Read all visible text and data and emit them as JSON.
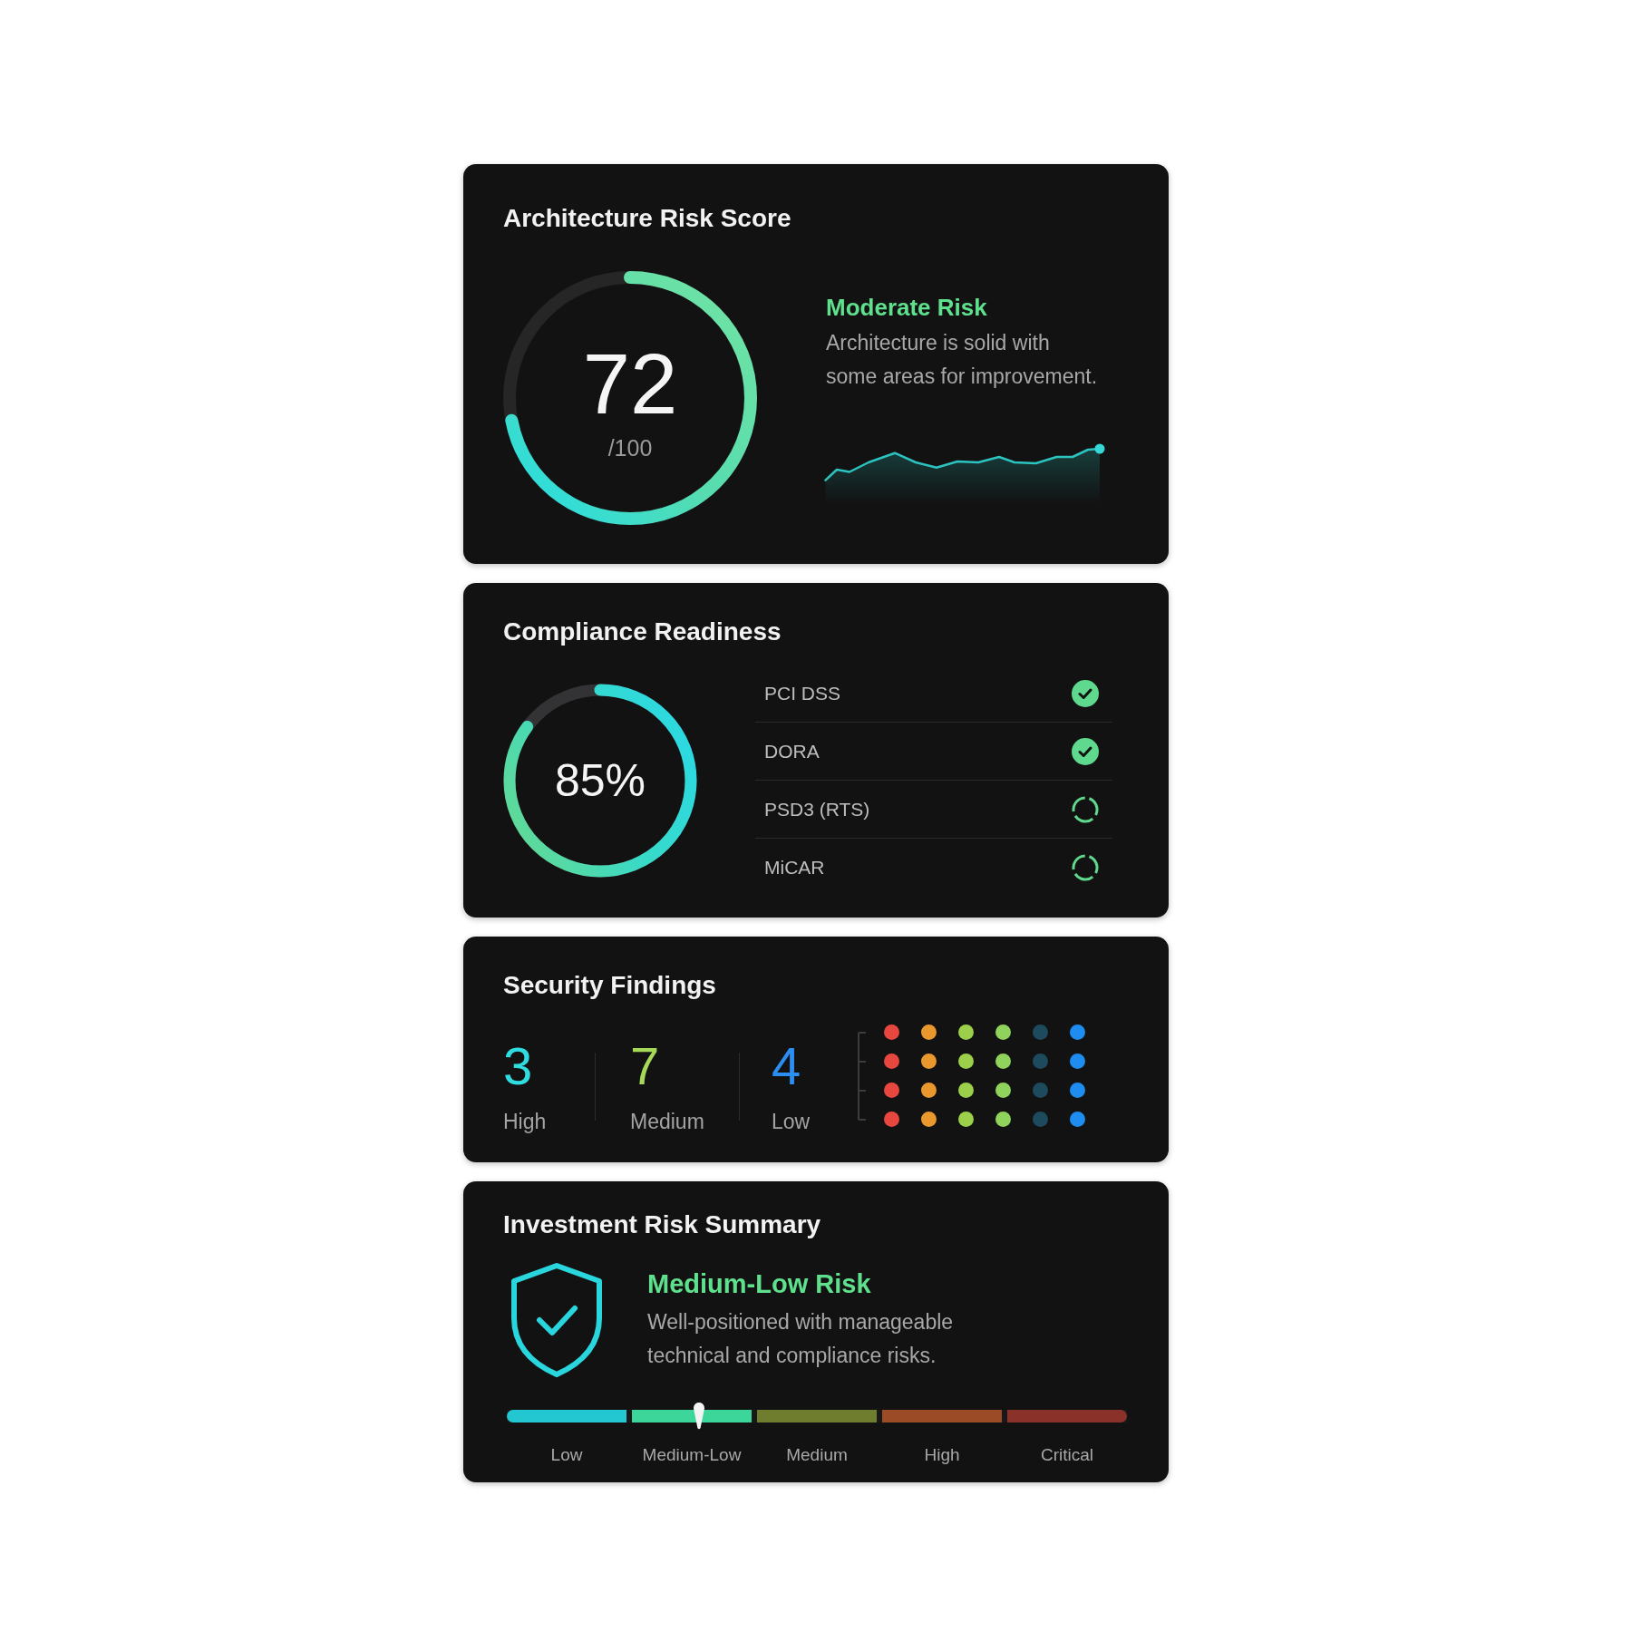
{
  "score_card": {
    "title": "Architecture Risk Score",
    "score": "72",
    "max": "/100",
    "level": 0.72,
    "status": "Moderate Risk",
    "description": "Architecture is solid with some areas for improvement."
  },
  "compliance": {
    "title": "Compliance Readiness",
    "percent": "85%",
    "level": 0.85,
    "items": [
      {
        "label": "PCI DSS",
        "checked": true
      },
      {
        "label": "DORA",
        "checked": true
      },
      {
        "label": "PSD3 (RTS)",
        "checked": false
      },
      {
        "label": "MiCAR",
        "checked": false
      }
    ]
  },
  "findings": {
    "title": "Security Findings",
    "items": [
      {
        "count": "3",
        "label": "High",
        "color": "#2fdde0"
      },
      {
        "count": "7",
        "label": "Medium",
        "color": "#a6d957"
      },
      {
        "count": "4",
        "label": "Low",
        "color": "#2b8ef2"
      }
    ],
    "dot_columns": [
      {
        "color": "#e8473f"
      },
      {
        "color": "#e8982c"
      },
      {
        "color": "#9ccf4a"
      },
      {
        "color": "#8fd25c"
      },
      {
        "color": "#1d4a5c"
      },
      {
        "color": "#1f8cf2"
      }
    ]
  },
  "investment": {
    "title": "Investment Risk Summary",
    "status": "Medium-Low Risk",
    "description": "Well-positioned with manageable technical and compliance risks.",
    "scale": {
      "level": 0.31,
      "segments": [
        {
          "label": "Low",
          "color": "#22c7d2"
        },
        {
          "label": "Medium-Low",
          "color": "#3cd69b"
        },
        {
          "label": "Medium",
          "color": "#6e7e2e"
        },
        {
          "label": "High",
          "color": "#9b4b25"
        },
        {
          "label": "Critical",
          "color": "#8a3129"
        }
      ]
    }
  }
}
